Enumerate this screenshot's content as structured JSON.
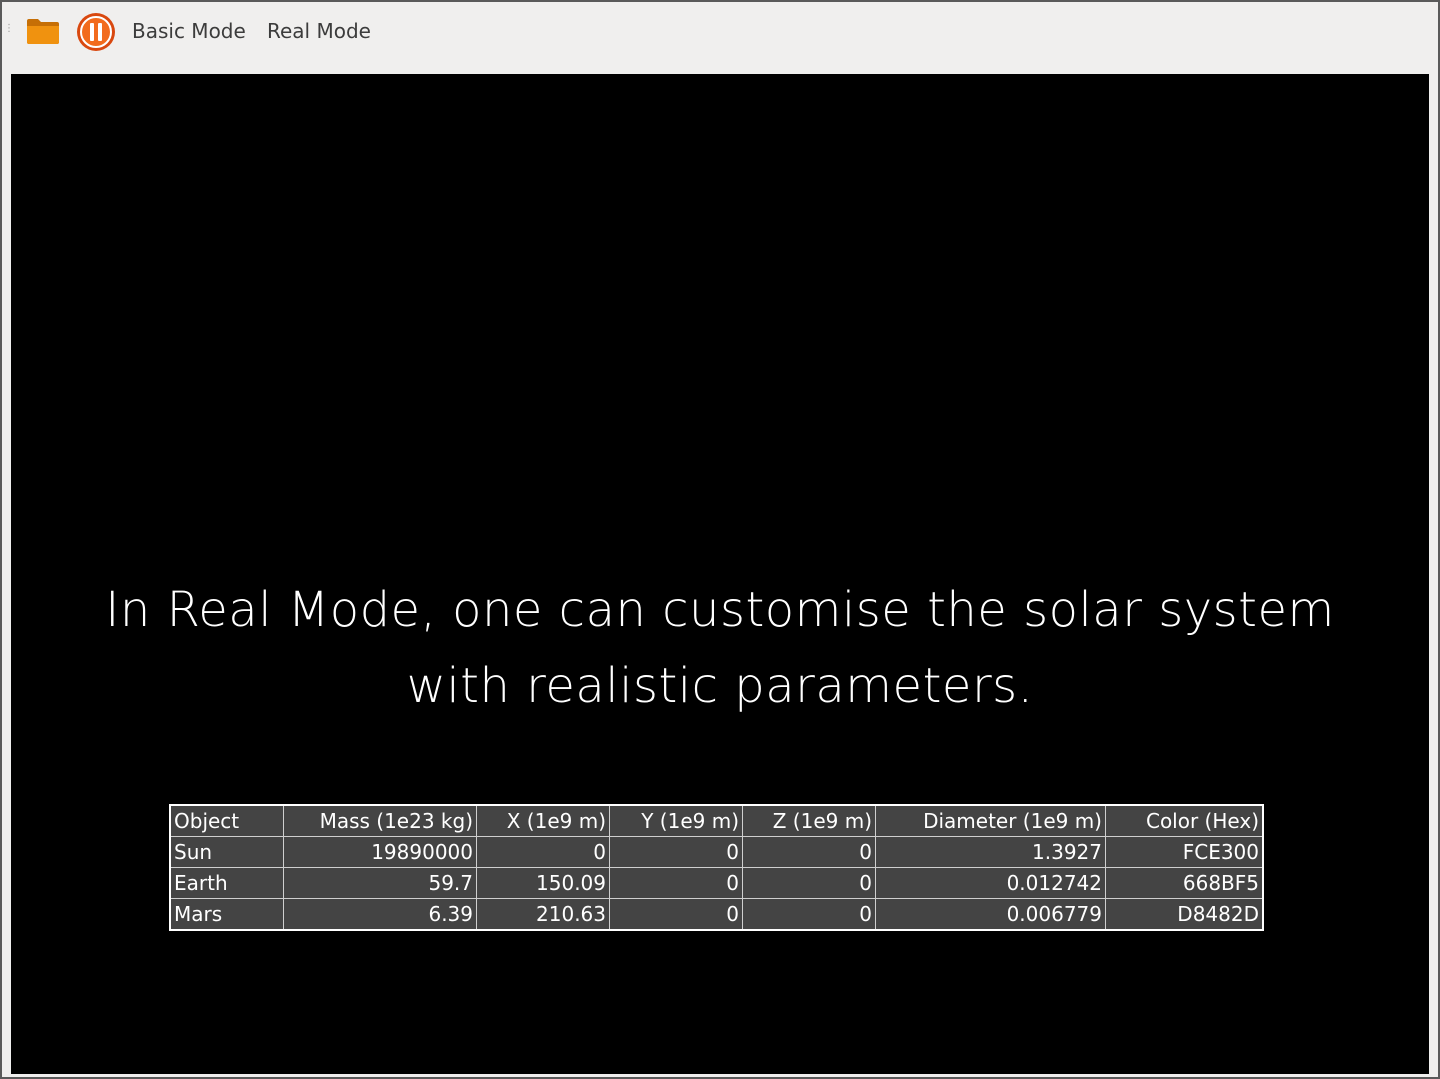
{
  "toolbar": {
    "folder_icon": "folder-icon",
    "pause_icon": "pause-icon",
    "basic_mode_label": "Basic Mode",
    "real_mode_label": "Real Mode",
    "folder_color": "#e8890c",
    "pause_color": "#e95420"
  },
  "canvas": {
    "background": "#000000",
    "caption_line1": "In Real Mode, one can customise the solar system",
    "caption_line2": "with realistic parameters."
  },
  "table": {
    "headers": [
      "Object",
      "Mass (1e23 kg)",
      "X (1e9 m)",
      "Y (1e9 m)",
      "Z (1e9 m)",
      "Diameter (1e9 m)",
      "Color (Hex)"
    ],
    "rows": [
      [
        "Sun",
        "19890000",
        "0",
        "0",
        "0",
        "1.3927",
        "FCE300"
      ],
      [
        "Earth",
        "59.7",
        "150.09",
        "0",
        "0",
        "0.012742",
        "668BF5"
      ],
      [
        "Mars",
        "6.39",
        "210.63",
        "0",
        "0",
        "0.006779",
        "D8482D"
      ]
    ]
  }
}
